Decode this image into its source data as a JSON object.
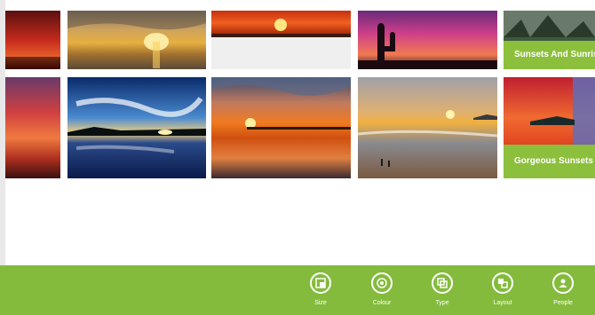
{
  "collections": {
    "top_label": "Sunsets And Sunrises",
    "bottom_label": "Gorgeous Sunsets"
  },
  "app_bar": {
    "buttons": [
      {
        "label": "Size",
        "icon": "size-icon"
      },
      {
        "label": "Colour",
        "icon": "colour-icon"
      },
      {
        "label": "Type",
        "icon": "type-icon"
      },
      {
        "label": "Layout",
        "icon": "layout-icon"
      },
      {
        "label": "People",
        "icon": "people-icon"
      }
    ]
  },
  "colors": {
    "accent": "#84bb3c"
  }
}
